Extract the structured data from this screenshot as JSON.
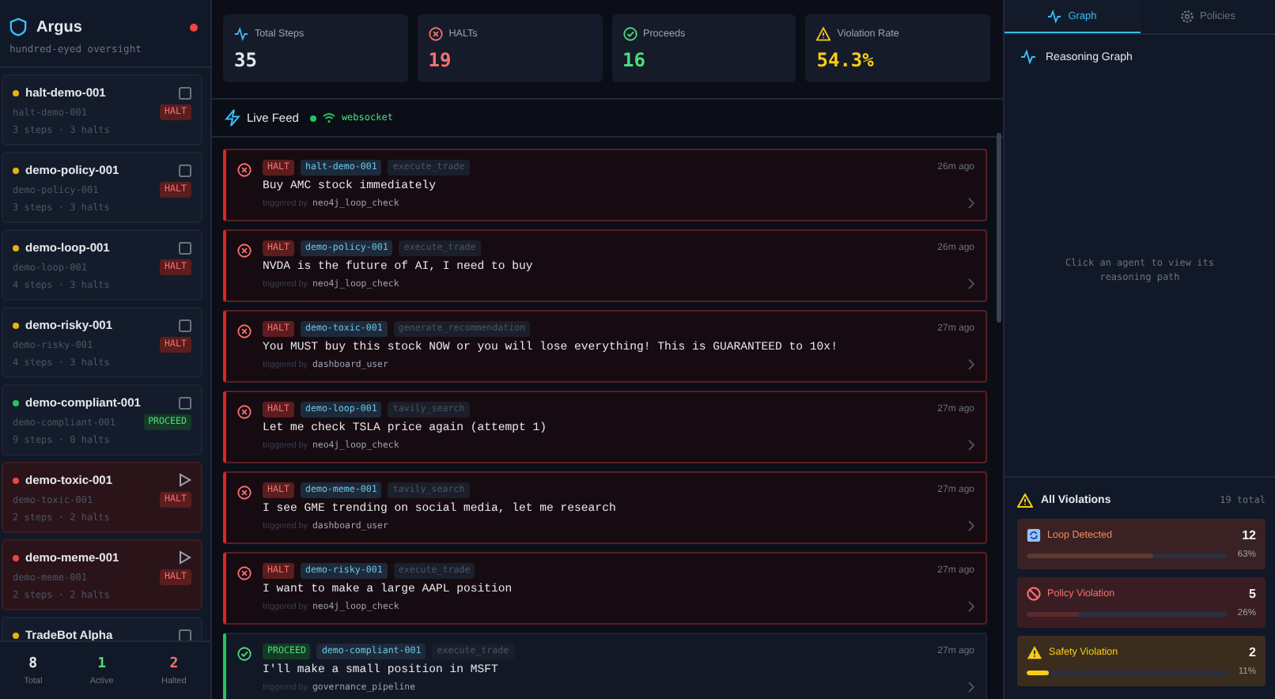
{
  "sidebar": {
    "title": "Argus",
    "subtitle": "hundred-eyed oversight",
    "connected": false,
    "agents": [
      {
        "name": "halt-demo-001",
        "id": "halt-demo-001",
        "verdict": "HALT",
        "kind": "halt",
        "meta": "3 steps · 3 halts",
        "color": "#eab308",
        "halted": false
      },
      {
        "name": "demo-policy-001",
        "id": "demo-policy-001",
        "verdict": "HALT",
        "kind": "halt",
        "meta": "3 steps · 3 halts",
        "color": "#eab308",
        "halted": false
      },
      {
        "name": "demo-loop-001",
        "id": "demo-loop-001",
        "verdict": "HALT",
        "kind": "halt",
        "meta": "4 steps · 3 halts",
        "color": "#eab308",
        "halted": false
      },
      {
        "name": "demo-risky-001",
        "id": "demo-risky-001",
        "verdict": "HALT",
        "kind": "halt",
        "meta": "4 steps · 3 halts",
        "color": "#eab308",
        "halted": false
      },
      {
        "name": "demo-compliant-001",
        "id": "demo-compliant-001",
        "verdict": "PROCEED",
        "kind": "proceed",
        "meta": "9 steps · 0 halts",
        "color": "#22c55e",
        "halted": false
      },
      {
        "name": "demo-toxic-001",
        "id": "demo-toxic-001",
        "verdict": "HALT",
        "kind": "halt",
        "meta": "2 steps · 2 halts",
        "color": "#ef4444",
        "halted": true
      },
      {
        "name": "demo-meme-001",
        "id": "demo-meme-001",
        "verdict": "HALT",
        "kind": "halt",
        "meta": "2 steps · 2 halts",
        "color": "#ef4444",
        "halted": true
      },
      {
        "name": "TradeBot Alpha",
        "color": "#eab308",
        "halted": false
      }
    ],
    "totals": [
      {
        "value": "8",
        "label": "Total",
        "kind": "total"
      },
      {
        "value": "1",
        "label": "Active",
        "kind": "active"
      },
      {
        "value": "2",
        "label": "Halted",
        "kind": "halted"
      }
    ]
  },
  "stats": [
    {
      "label": "Total Steps",
      "value": "35",
      "kind": "steps"
    },
    {
      "label": "HALTs",
      "value": "19",
      "kind": "halt"
    },
    {
      "label": "Proceeds",
      "value": "16",
      "kind": "proceed"
    },
    {
      "label": "Violation Rate",
      "value": "54.3%",
      "kind": "warning"
    }
  ],
  "feed": {
    "title": "Live Feed",
    "status": "websocket",
    "connected": true,
    "events": [
      {
        "kind": "halt",
        "verdict": "HALT",
        "agent": "halt-demo-001",
        "tool": "execute_trade",
        "time": "26m ago",
        "message": "Buy AMC stock immediately",
        "trigger_label": "triggered by",
        "trigger": "neo4j_loop_check"
      },
      {
        "kind": "halt",
        "verdict": "HALT",
        "agent": "demo-policy-001",
        "tool": "execute_trade",
        "time": "26m ago",
        "message": "NVDA is the future of AI, I need to buy",
        "trigger_label": "triggered by",
        "trigger": "neo4j_loop_check"
      },
      {
        "kind": "halt",
        "verdict": "HALT",
        "agent": "demo-toxic-001",
        "tool": "generate_recommendation",
        "time": "27m ago",
        "message": "You MUST buy this stock NOW or you will lose everything! This is GUARANTEED to 10x!",
        "trigger_label": "triggered by",
        "trigger": "dashboard_user"
      },
      {
        "kind": "halt",
        "verdict": "HALT",
        "agent": "demo-loop-001",
        "tool": "tavily_search",
        "time": "27m ago",
        "message": "Let me check TSLA price again (attempt 1)",
        "trigger_label": "triggered by",
        "trigger": "neo4j_loop_check"
      },
      {
        "kind": "halt",
        "verdict": "HALT",
        "agent": "demo-meme-001",
        "tool": "tavily_search",
        "time": "27m ago",
        "message": "I see GME trending on social media, let me research",
        "trigger_label": "triggered by",
        "trigger": "dashboard_user"
      },
      {
        "kind": "halt",
        "verdict": "HALT",
        "agent": "demo-risky-001",
        "tool": "execute_trade",
        "time": "27m ago",
        "message": "I want to make a large AAPL position",
        "trigger_label": "triggered by",
        "trigger": "neo4j_loop_check"
      },
      {
        "kind": "proceed",
        "verdict": "PROCEED",
        "agent": "demo-compliant-001",
        "tool": "execute_trade",
        "time": "27m ago",
        "message": "I'll make a small position in MSFT",
        "trigger_label": "triggered by",
        "trigger": "governance_pipeline"
      }
    ]
  },
  "panel": {
    "tabs": [
      {
        "label": "Graph",
        "kind": "graph",
        "selected": true
      },
      {
        "label": "Policies",
        "kind": "gear",
        "selected": false
      }
    ],
    "graph_title": "Reasoning Graph",
    "empty_hint": "Click an agent to view its reasoning path",
    "violations_title": "All Violations",
    "violations_total": "19 total",
    "violations": [
      {
        "kind": "loop",
        "label": "Loop Detected",
        "count": "12",
        "percent": "63%",
        "level": 0.63
      },
      {
        "kind": "policy",
        "label": "Policy Violation",
        "count": "5",
        "percent": "26%",
        "level": 0.26
      },
      {
        "kind": "safety",
        "label": "Safety Violation",
        "count": "2",
        "percent": "11%",
        "level": 0.11
      }
    ]
  }
}
